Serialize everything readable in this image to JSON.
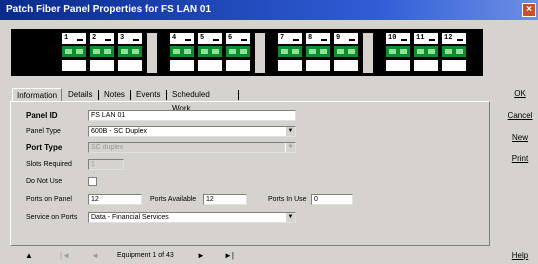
{
  "window": {
    "title": "Patch Fiber Panel Properties for FS LAN 01",
    "close_glyph": "×"
  },
  "ports": [
    {
      "num": "1"
    },
    {
      "num": "2"
    },
    {
      "num": "3"
    },
    {
      "num": "4"
    },
    {
      "num": "5"
    },
    {
      "num": "6"
    },
    {
      "num": "7"
    },
    {
      "num": "8"
    },
    {
      "num": "9"
    },
    {
      "num": "10"
    },
    {
      "num": "11"
    },
    {
      "num": "12"
    }
  ],
  "tabs": [
    {
      "label": "Information",
      "active": true
    },
    {
      "label": "Details"
    },
    {
      "label": "Notes"
    },
    {
      "label": "Events"
    },
    {
      "label": "Scheduled Work"
    }
  ],
  "form": {
    "panel_id": {
      "label": "Panel ID",
      "value": "FS LAN 01"
    },
    "panel_type": {
      "label": "Panel Type",
      "value": "600B - SC Duplex"
    },
    "port_type": {
      "label": "Port Type",
      "value": "SC duplex"
    },
    "slots_required": {
      "label": "Slots Required",
      "value": "1"
    },
    "do_not_use": {
      "label": "Do Not Use",
      "checked": false
    },
    "ports_on_panel": {
      "label": "Ports on Panel",
      "value": "12"
    },
    "ports_available": {
      "label": "Ports Available",
      "value": "12"
    },
    "ports_in_use": {
      "label": "Ports In Use",
      "value": "0"
    },
    "service_on_ports": {
      "label": "Service on Ports",
      "value": "Data - Financial Services"
    }
  },
  "side_buttons": {
    "ok": "OK",
    "cancel": "Cancel",
    "new": "New",
    "print": "Print",
    "help": "Help"
  },
  "navigator": {
    "text": "Equipment 1 of 43",
    "up_icon": "up-arrow-icon",
    "first_icon": "first-record-icon",
    "prev_icon": "prev-record-icon",
    "next_icon": "next-record-icon",
    "last_icon": "last-record-icon"
  },
  "colors": {
    "titlebar": "#0a2a8c",
    "jack": "#0c8f2a",
    "face": "#d6d3ce"
  }
}
